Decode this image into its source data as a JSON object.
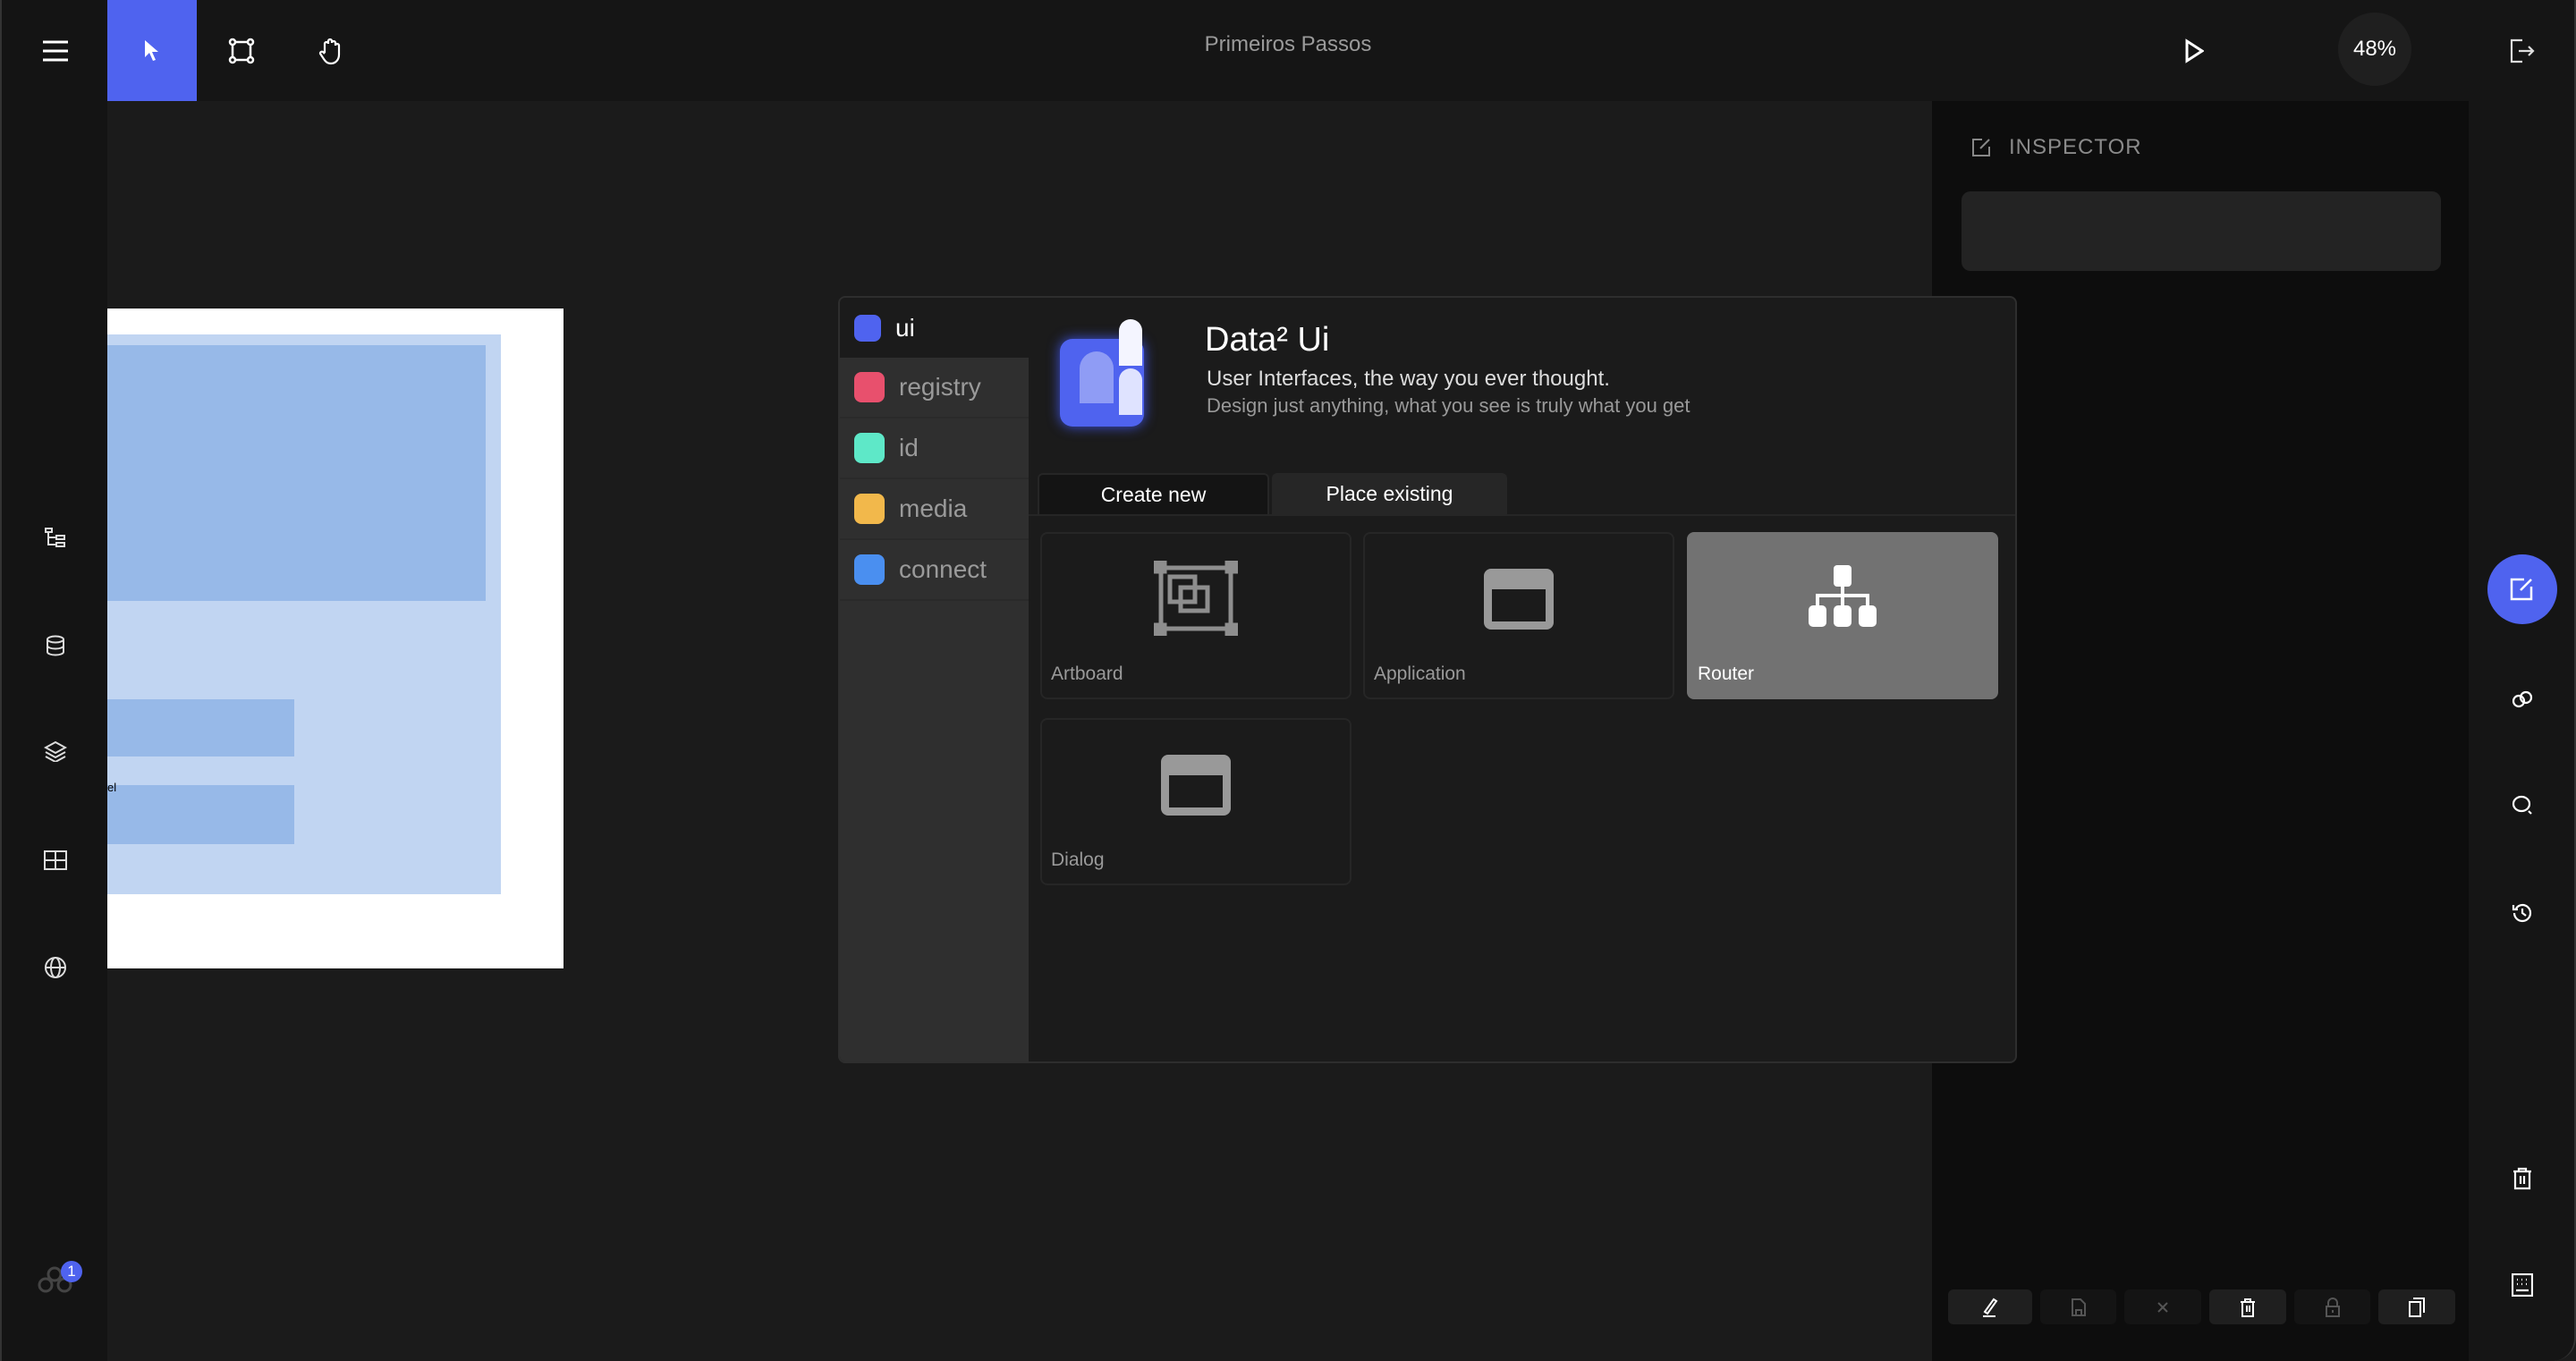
{
  "header": {
    "title": "Primeiros Passos",
    "zoom": "48%"
  },
  "toolbar": {
    "tools": [
      "menu-icon",
      "select-icon",
      "frame-icon",
      "hand-icon"
    ],
    "active_tool": "select",
    "accent": "#4f63ef"
  },
  "left_sidebar": {
    "icons": [
      "tree-icon",
      "database-icon",
      "layers-icon",
      "grid-icon",
      "globe-icon"
    ],
    "extensions_badge": "1"
  },
  "artboard": {
    "partial_label": "el"
  },
  "inspector": {
    "title": "INSPECTOR",
    "actions": [
      "edit",
      "save",
      "cancel",
      "delete",
      "lock",
      "duplicate"
    ]
  },
  "right_rail": {
    "icons": [
      "edit-icon",
      "link-icon",
      "search-icon",
      "history-icon",
      "trash-icon",
      "keyboard-icon"
    ],
    "active": "edit"
  },
  "dialog": {
    "nav": [
      {
        "label": "ui",
        "color": "#4f63ef"
      },
      {
        "label": "registry",
        "color": "#e8506d"
      },
      {
        "label": "id",
        "color": "#5ee8c8"
      },
      {
        "label": "media",
        "color": "#f2b84b"
      },
      {
        "label": "connect",
        "color": "#4a8ff0"
      }
    ],
    "brand": {
      "title": "Data² Ui",
      "tagline": "User  Interfaces, the way you ever thought.",
      "subtitle": "Design just anything, what you see is truly what you get"
    },
    "tabs": [
      {
        "label": "Create new",
        "active": true
      },
      {
        "label": "Place existing",
        "active": false
      }
    ],
    "cards": [
      {
        "label": "Artboard",
        "icon": "artboard-icon",
        "selected": false
      },
      {
        "label": "Application",
        "icon": "window-icon",
        "selected": false
      },
      {
        "label": "Router",
        "icon": "sitemap-icon",
        "selected": true
      },
      {
        "label": "Dialog",
        "icon": "window-icon",
        "selected": false
      }
    ]
  }
}
